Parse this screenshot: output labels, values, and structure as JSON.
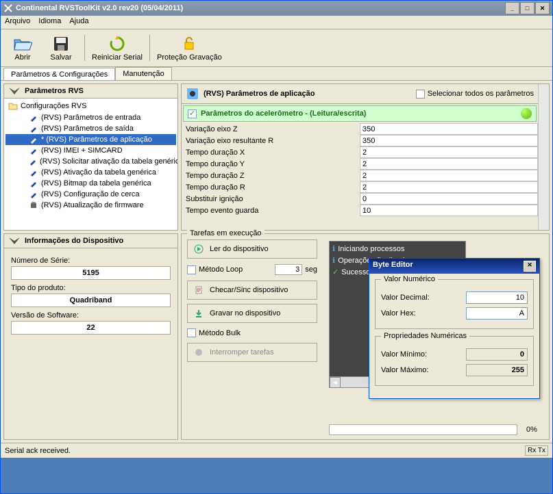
{
  "window": {
    "title": "Continental RVSToolKit v2.0 rev20 (05/04/2011)"
  },
  "menu": {
    "arquivo": "Arquivo",
    "idioma": "Idioma",
    "ajuda": "Ajuda"
  },
  "toolbar": {
    "abrir": "Abrir",
    "salvar": "Salvar",
    "reiniciar": "Reiniciar Serial",
    "protecao": "Proteção Gravação"
  },
  "tabs": {
    "parametros": "Parâmetros & Configurações",
    "manutencao": "Manutenção"
  },
  "left_tree": {
    "title": "Parâmetros RVS",
    "root": "Configurações RVS",
    "items": [
      "(RVS) Parâmetros de entrada",
      "(RVS) Parâmetros de saída",
      "* (RVS) Parâmetros de aplicação",
      "(RVS) IMEI + SIMCARD",
      "(RVS) Solicitar ativação da tabela genéric",
      "(RVS) Ativação da tabela genérica",
      "(RVS) Bitmap da tabela genérica",
      "(RVS) Configuração de cerca",
      "(RVS) Atualização de firmware"
    ],
    "selected_index": 2
  },
  "right_panel": {
    "title": "(RVS) Parâmetros de aplicação",
    "select_all": "Selecionar todos os parâmetros",
    "group_title": "Parâmetros do acelerômetro - (Leitura/escrita)",
    "rows": [
      {
        "label": "Variação eixo Z",
        "value": "350"
      },
      {
        "label": "Variação eixo resultante R",
        "value": "350"
      },
      {
        "label": "Tempo duração X",
        "value": "2"
      },
      {
        "label": "Tempo duração Y",
        "value": "2"
      },
      {
        "label": "Tempo duração Z",
        "value": "2"
      },
      {
        "label": "Tempo duração R",
        "value": "2"
      },
      {
        "label": "Substituir ignição",
        "value": "0"
      },
      {
        "label": "Tempo evento guarda",
        "value": "10"
      }
    ]
  },
  "dev_info": {
    "title": "Informações do Dispositivo",
    "serial_label": "Número de Série:",
    "serial_value": "5195",
    "product_label": "Tipo do produto:",
    "product_value": "Quadriband",
    "version_label": "Versão de Software:",
    "version_value": "22"
  },
  "tasks": {
    "legend": "Tarefas em execução",
    "read_btn": "Ler do dispositivo",
    "loop_chk": "Método Loop",
    "loop_val": "3",
    "loop_unit": "seg",
    "check_btn": "Checar/Sinc dispositivo",
    "write_btn": "Gravar no dispositivo",
    "bulk_chk": "Método Bulk",
    "interrupt_btn": "Interromper tarefas",
    "progress": "0%",
    "log": [
      "Iniciando processos",
      "Operações finalizada",
      "Sucesso...[READ] P"
    ]
  },
  "byte_editor": {
    "title": "Byte Editor",
    "numeric_legend": "Valor Numérico",
    "decimal_label": "Valor Decimal:",
    "decimal_value": "10",
    "hex_label": "Valor Hex:",
    "hex_value": "A",
    "props_legend": "Propriedades Numéricas",
    "min_label": "Valor Mínimo:",
    "min_value": "0",
    "max_label": "Valor Máximo:",
    "max_value": "255"
  },
  "status": {
    "text": "Serial ack received.",
    "rxtx": "Rx Tx"
  }
}
